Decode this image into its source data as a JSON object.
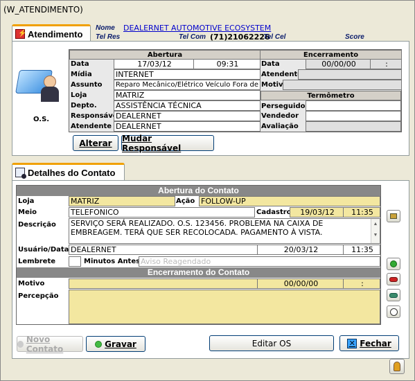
{
  "window": {
    "title": "(W_ATENDIMENTO)"
  },
  "header": {
    "nome_label": "Nome",
    "nome_value": "DEALERNET AUTOMOTIVE ECOSYSTEM",
    "telres_label": "Tel Res",
    "telcom_label": "Tel Com",
    "telcom_value": "(71)21062226",
    "telcel_label": "Tel Cel",
    "score_label": "Score"
  },
  "atendimento": {
    "tab_label": "Atendimento",
    "os_label": "O.S.",
    "abertura_header": "Abertura",
    "encerramento_header": "Encerramento",
    "termometro_header": "Termômetro",
    "fields": {
      "data_label": "Data",
      "data_value": "17/03/12",
      "hora_value": "09:31",
      "midia_label": "Mídia",
      "midia_value": "INTERNET",
      "assunto_label": "Assunto",
      "assunto_value": "Reparo Mecânico/Elétrico Veículo Fora de",
      "loja_label": "Loja",
      "loja_value": "MATRIZ",
      "depto_label": "Depto.",
      "depto_value": "ASSISTÊNCIA TÉCNICA",
      "responsavel_label": "Responsável",
      "responsavel_value": "DEALERNET",
      "atendente_label": "Atendente",
      "atendente_value": "DEALERNET",
      "enc_data_label": "Data",
      "enc_data_value": "00/00/00",
      "enc_hora_value": ":",
      "enc_atendente_label": "Atendente",
      "enc_motivo_label": "Motivo",
      "perseguidor_label": "Perseguidor",
      "vendedor_label": "Vendedor",
      "avaliacao_label": "Avaliação"
    },
    "alterar_button": "Alterar",
    "mudar_button": "Mudar Responsável"
  },
  "contato": {
    "tab_label": "Detalhes do Contato",
    "abertura_header": "Abertura do Contato",
    "encerramento_header": "Encerramento do Contato",
    "loja_label": "Loja",
    "loja_value": "MATRIZ",
    "acao_label": "Ação",
    "acao_value": "FOLLOW-UP",
    "meio_label": "Meio",
    "meio_value": "TELEFONICO",
    "cadastro_label": "Cadastro",
    "cadastro_date": "19/03/12",
    "cadastro_time": "11:35",
    "descricao_label": "Descrição",
    "descricao_value": "SERVIÇO SERÁ REALIZADO. O.S. 123456. PROBLEMA NA CAIXA DE EMBREAGEM. TERÁ QUE SER RECOLOCADA. PAGAMENTO À VISTA.",
    "usuario_label": "Usuário/Data",
    "usuario_value": "DEALERNET",
    "usuario_date": "20/03/12",
    "usuario_time": "11:35",
    "lembrete_label": "Lembrete",
    "minutos_label": "Minutos Antes",
    "aviso_placeholder": "Aviso Reagendado",
    "motivo_label": "Motivo",
    "motivo_date": "00/00/00",
    "motivo_time": ":",
    "percepcao_label": "Percepção"
  },
  "footer": {
    "novo_button": "Novo Contato",
    "gravar_button": "Gravar",
    "editar_button": "Editar OS",
    "fechar_button": "Fechar"
  }
}
